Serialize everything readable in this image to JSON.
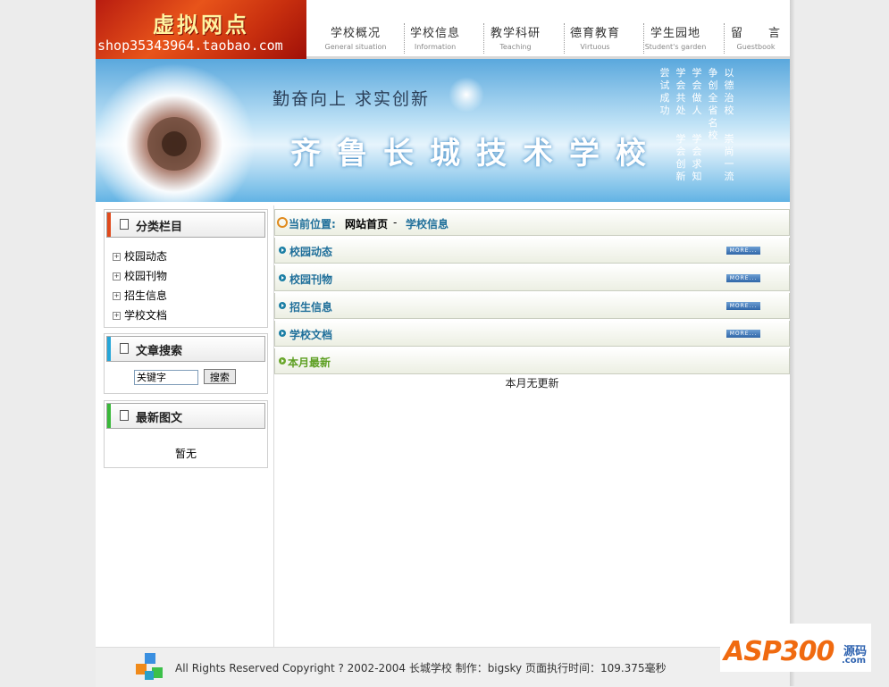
{
  "logo": {
    "brand": "虚拟网点",
    "shop": "shop35343964.taobao.com"
  },
  "nav": [
    {
      "cn": "学校概况",
      "en": "General situation"
    },
    {
      "cn": "学校信息",
      "en": "Information"
    },
    {
      "cn": "教学科研",
      "en": "Teaching"
    },
    {
      "cn": "德育教育",
      "en": "Virtuous"
    },
    {
      "cn": "学生园地",
      "en": "Student's garden"
    },
    {
      "cn": "留　　言",
      "en": "Guestbook"
    }
  ],
  "banner": {
    "slogan": "勤奋向上  求实创新",
    "school": "齐鲁长城技术学校",
    "columns": [
      "尝试成功",
      "学会共处",
      "学会做人",
      "争创全省名校",
      "以德治校",
      "学会创新",
      "学会求知",
      "崇尚一流"
    ]
  },
  "sidebar": {
    "categories": {
      "title": "分类栏目",
      "items": [
        "校园动态",
        "校园刊物",
        "招生信息",
        "学校文档"
      ]
    },
    "search": {
      "title": "文章搜索",
      "input_value": "关键字",
      "button": "搜索"
    },
    "latest": {
      "title": "最新图文",
      "empty": "暂无"
    }
  },
  "main": {
    "location_label": "当前位置:",
    "home": "网站首页",
    "sep": " - ",
    "current": "学校信息",
    "rows": [
      "校园动态",
      "校园刊物",
      "招生信息",
      "学校文档"
    ],
    "more": "MORE...",
    "month_title": "本月最新",
    "month_empty": "本月无更新"
  },
  "footer": {
    "copyright": "All Rights Reserved Copyright ? 2002-2004 长城学校 制作：bigsky 页面执行时间：109.375毫秒"
  },
  "watermark": {
    "asp": "ASP300",
    "src": "源码",
    "com": ".com"
  },
  "colors": {
    "nav_accent": "#1f6f9a",
    "category_bar": "#e04a1c",
    "search_bar": "#26a6d8",
    "latest_bar": "#3ab83a",
    "green_title": "#5d9f22"
  }
}
